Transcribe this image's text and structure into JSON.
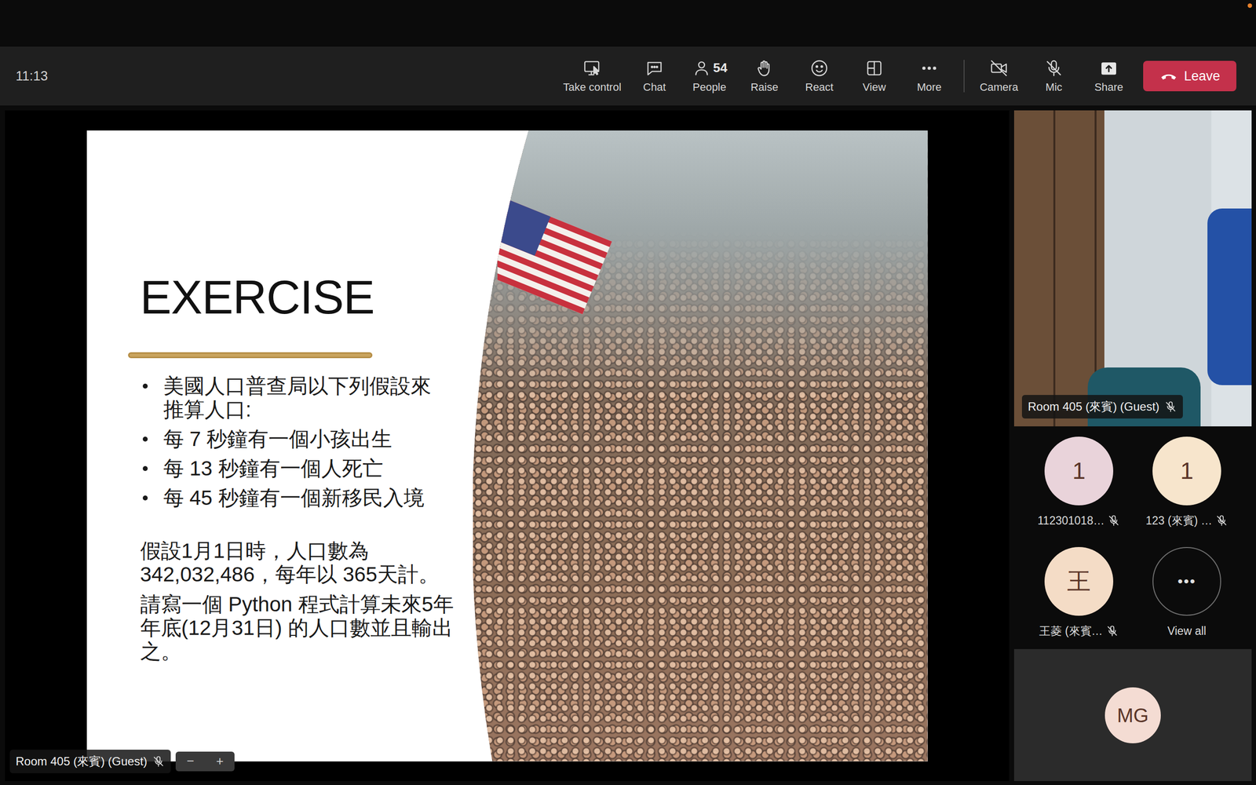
{
  "meeting": {
    "time": "11:13"
  },
  "toolbar": {
    "actions": [
      {
        "label": "Take control"
      },
      {
        "label": "Chat"
      },
      {
        "label": "People",
        "count": "54"
      },
      {
        "label": "Raise"
      },
      {
        "label": "React"
      },
      {
        "label": "View"
      },
      {
        "label": "More"
      }
    ],
    "devices": [
      {
        "label": "Camera",
        "on": false
      },
      {
        "label": "Mic",
        "on": false
      }
    ],
    "share": {
      "label": "Share"
    },
    "leave": {
      "label": "Leave"
    }
  },
  "stage": {
    "slide": {
      "title": "EXERCISE",
      "bullets": [
        "美國人口普查局以下列假設來推算人口:",
        "每 7 秒鐘有一個小孩出生",
        "每 13 秒鐘有一個人死亡",
        "每 45 秒鐘有一個新移民入境"
      ],
      "paragraphs": [
        "假設1月1日時，人口數為342,032,486，每年以 365天計。",
        "請寫一個 Python 程式計算未來5年年底(12月31日) 的人口數並且輸出之。"
      ]
    },
    "presenter": {
      "name": "Room 405 (來賓) (Guest)",
      "muted": true
    },
    "zoom": [
      "−",
      "+"
    ]
  },
  "sidebar": {
    "video": {
      "name": "Room 405 (來賓) (Guest)",
      "muted": true
    },
    "participants": [
      {
        "initials": "1",
        "name": "112301018…",
        "muted": true,
        "color": "#e9d3da"
      },
      {
        "initials": "1",
        "name": "123 (來賓) …",
        "muted": true,
        "color": "#f7e5cc"
      },
      {
        "initials": "王",
        "name": "王菱 (來賓…",
        "muted": true,
        "color": "#f4dcc6"
      }
    ],
    "view_all": {
      "glyph": "•••",
      "label": "View all"
    },
    "self": {
      "initials": "MG"
    }
  }
}
